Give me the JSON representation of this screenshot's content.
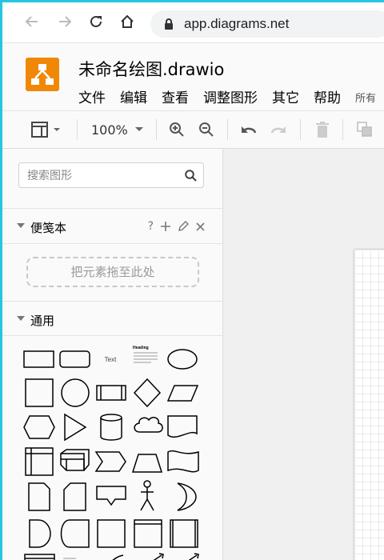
{
  "browser": {
    "url": "app.diagrams.net",
    "icons": [
      "back-arrow-icon",
      "forward-arrow-icon",
      "reload-icon",
      "home-icon",
      "lock-icon"
    ]
  },
  "app": {
    "title": "未命名绘图.drawio",
    "menu": [
      "文件",
      "编辑",
      "查看",
      "调整图形",
      "其它",
      "帮助",
      "所有"
    ]
  },
  "toolbar": {
    "zoom": "100%",
    "icons": [
      "format-panel-icon",
      "zoom-in-icon",
      "zoom-out-icon",
      "undo-icon",
      "redo-icon",
      "delete-icon",
      "to-front-icon"
    ]
  },
  "sidebar": {
    "search_placeholder": "搜索图形",
    "scratchpad": {
      "title": "便笺本",
      "help": "?",
      "dropzone": "把元素拖至此处"
    },
    "general": {
      "title": "通用",
      "shape_text_label": "Text",
      "shape_heading_label": "Heading",
      "shapes": [
        "rectangle-shape",
        "rounded-rectangle-shape",
        "text-shape",
        "textbox-shape",
        "ellipse-shape",
        "square-shape",
        "circle-shape",
        "process-shape",
        "diamond-shape",
        "parallelogram-shape",
        "hexagon-shape",
        "triangle-shape",
        "cylinder-shape",
        "cloud-shape",
        "document-shape",
        "internal-storage-shape",
        "cube-shape",
        "step-shape",
        "trapezoid-shape",
        "tape-shape",
        "note-shape",
        "card-shape",
        "callout-shape",
        "actor-shape",
        "or-shape",
        "delay-shape",
        "display-shape",
        "data-storage-shape",
        "container-shape",
        "frame-shape",
        "list-shape",
        "label-shape",
        "curve-shape",
        "bidirectional-arrow-shape",
        "arrow-shape"
      ]
    }
  },
  "colors": {
    "accent": "#27c6e0",
    "logo": "#f08705"
  }
}
